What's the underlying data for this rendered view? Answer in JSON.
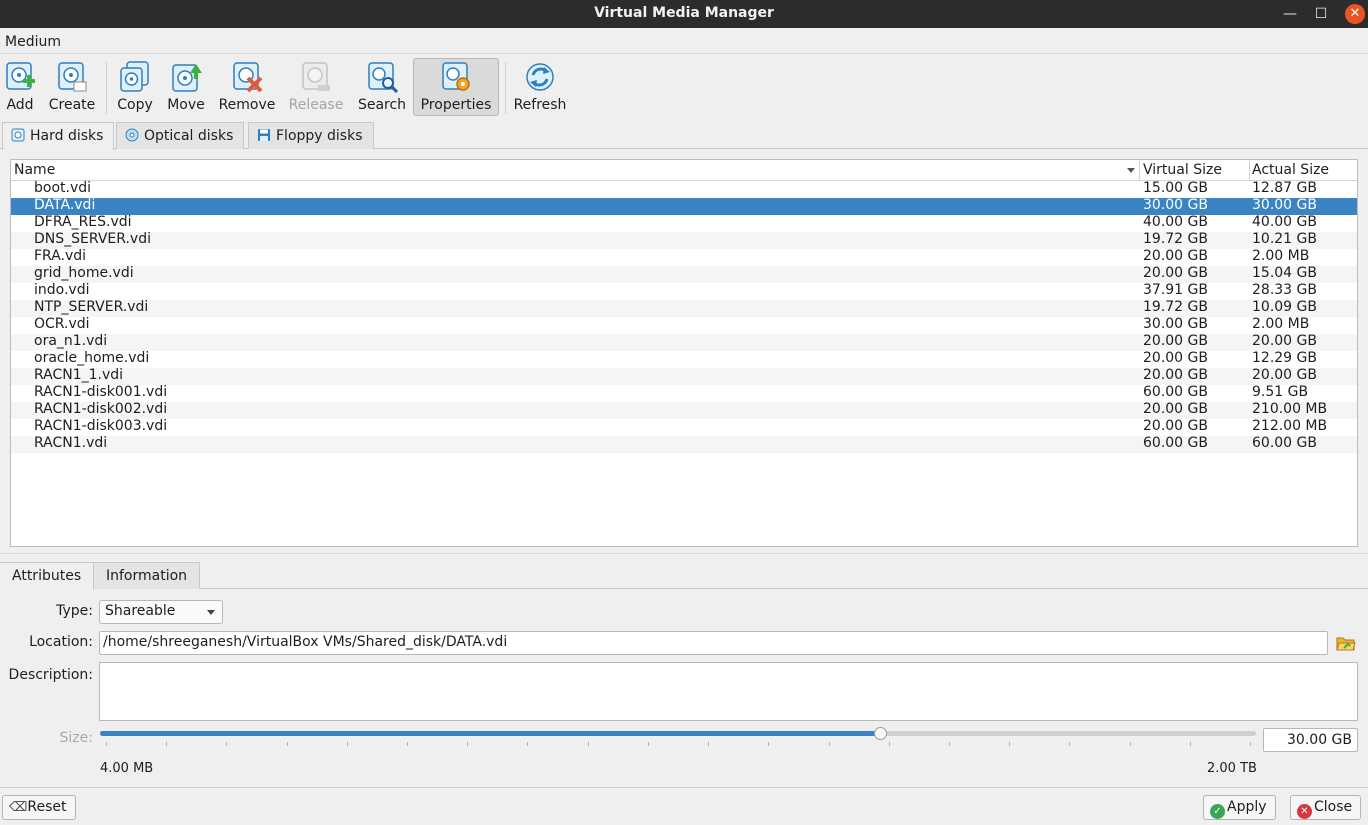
{
  "window": {
    "title": "Virtual Media Manager"
  },
  "menubar": {
    "medium": "Medium"
  },
  "toolbar": {
    "add": "Add",
    "create": "Create",
    "copy": "Copy",
    "move": "Move",
    "remove": "Remove",
    "release": "Release",
    "search": "Search",
    "properties": "Properties",
    "refresh": "Refresh"
  },
  "tabs": {
    "hard": "Hard disks",
    "optical": "Optical disks",
    "floppy": "Floppy disks"
  },
  "table": {
    "columns": {
      "name": "Name",
      "virtual": "Virtual Size",
      "actual": "Actual Size"
    },
    "selected_index": 1,
    "rows": [
      {
        "name": "boot.vdi",
        "virtual": "15.00 GB",
        "actual": "12.87 GB"
      },
      {
        "name": "DATA.vdi",
        "virtual": "30.00 GB",
        "actual": "30.00 GB"
      },
      {
        "name": "DFRA_RES.vdi",
        "virtual": "40.00 GB",
        "actual": "40.00 GB"
      },
      {
        "name": "DNS_SERVER.vdi",
        "virtual": "19.72 GB",
        "actual": "10.21 GB"
      },
      {
        "name": "FRA.vdi",
        "virtual": "20.00 GB",
        "actual": "2.00 MB"
      },
      {
        "name": "grid_home.vdi",
        "virtual": "20.00 GB",
        "actual": "15.04 GB"
      },
      {
        "name": "indo.vdi",
        "virtual": "37.91 GB",
        "actual": "28.33 GB"
      },
      {
        "name": "NTP_SERVER.vdi",
        "virtual": "19.72 GB",
        "actual": "10.09 GB"
      },
      {
        "name": "OCR.vdi",
        "virtual": "30.00 GB",
        "actual": "2.00 MB"
      },
      {
        "name": "ora_n1.vdi",
        "virtual": "20.00 GB",
        "actual": "20.00 GB"
      },
      {
        "name": "oracle_home.vdi",
        "virtual": "20.00 GB",
        "actual": "12.29 GB"
      },
      {
        "name": "RACN1_1.vdi",
        "virtual": "20.00 GB",
        "actual": "20.00 GB"
      },
      {
        "name": "RACN1-disk001.vdi",
        "virtual": "60.00 GB",
        "actual": "9.51 GB"
      },
      {
        "name": "RACN1-disk002.vdi",
        "virtual": "20.00 GB",
        "actual": "210.00 MB"
      },
      {
        "name": "RACN1-disk003.vdi",
        "virtual": "20.00 GB",
        "actual": "212.00 MB"
      },
      {
        "name": "RACN1.vdi",
        "virtual": "60.00 GB",
        "actual": "60.00 GB"
      }
    ]
  },
  "details": {
    "tabs": {
      "attributes": "Attributes",
      "information": "Information"
    },
    "type_label": "Type:",
    "type_value": "Shareable",
    "location_label": "Location:",
    "location_value": "/home/shreeganesh/VirtualBox VMs/Shared_disk/DATA.vdi",
    "description_label": "Description:",
    "size_label": "Size:",
    "size_value": "30.00 GB",
    "size_min": "4.00 MB",
    "size_max": "2.00 TB",
    "size_slider_fraction": 0.675
  },
  "buttons": {
    "reset": "Reset",
    "apply": "Apply",
    "close": "Close"
  },
  "colors": {
    "selection": "#3a84c4",
    "titlebar": "#2c2c2c",
    "close_button": "#e95420"
  }
}
